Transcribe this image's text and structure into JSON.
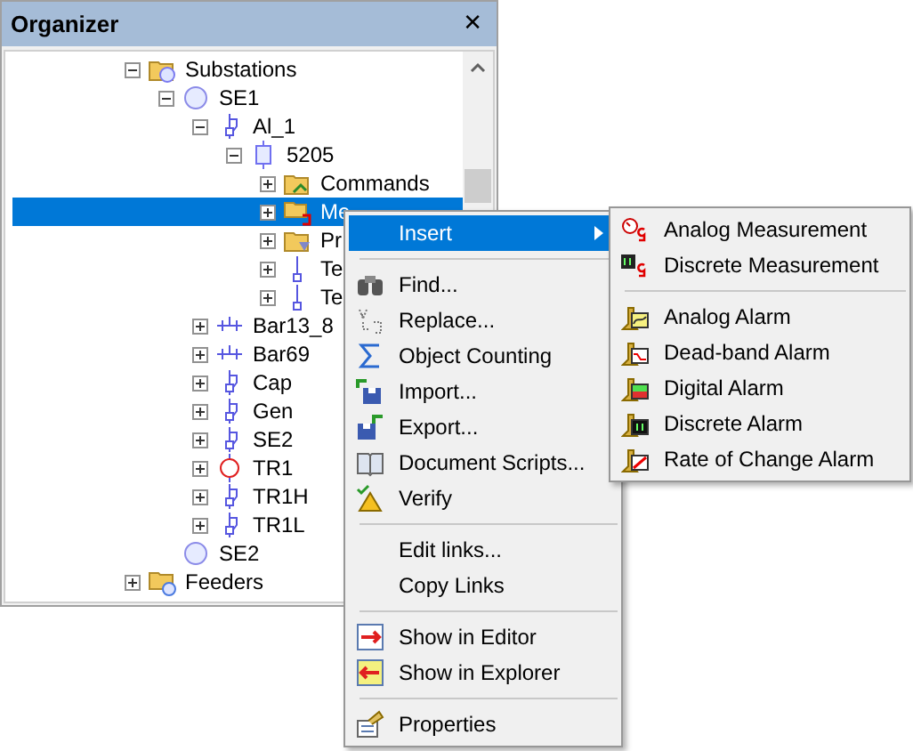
{
  "panel": {
    "title": "Organizer",
    "close": "✕"
  },
  "tree": [
    {
      "label": "Substations",
      "kind": "substations",
      "expandable": true,
      "expanded": true,
      "selected": false,
      "children": [
        {
          "label": "SE1",
          "kind": "substation",
          "expandable": true,
          "expanded": true,
          "selected": false,
          "children": [
            {
              "label": "Al_1",
              "kind": "breaker",
              "expandable": true,
              "expanded": true,
              "selected": false,
              "children": [
                {
                  "label": "5205",
                  "kind": "bay",
                  "expandable": true,
                  "expanded": true,
                  "selected": false,
                  "children": [
                    {
                      "label": "Commands",
                      "kind": "commands",
                      "expandable": true,
                      "expanded": false,
                      "selected": false
                    },
                    {
                      "label": "Me",
                      "kind": "measurements",
                      "expandable": true,
                      "expanded": false,
                      "selected": true
                    },
                    {
                      "label": "Pr",
                      "kind": "protection",
                      "expandable": true,
                      "expanded": false,
                      "selected": false
                    },
                    {
                      "label": "Te",
                      "kind": "terminal",
                      "expandable": true,
                      "expanded": false,
                      "selected": false
                    },
                    {
                      "label": "Te",
                      "kind": "terminal",
                      "expandable": true,
                      "expanded": false,
                      "selected": false
                    }
                  ]
                }
              ]
            },
            {
              "label": "Bar13_8",
              "kind": "busbar",
              "expandable": true,
              "expanded": false,
              "selected": false
            },
            {
              "label": "Bar69",
              "kind": "busbar",
              "expandable": true,
              "expanded": false,
              "selected": false
            },
            {
              "label": "Cap",
              "kind": "breaker",
              "expandable": true,
              "expanded": false,
              "selected": false
            },
            {
              "label": "Gen",
              "kind": "breaker",
              "expandable": true,
              "expanded": false,
              "selected": false
            },
            {
              "label": "SE2",
              "kind": "breaker",
              "expandable": true,
              "expanded": false,
              "selected": false
            },
            {
              "label": "TR1",
              "kind": "transformer",
              "expandable": true,
              "expanded": false,
              "selected": false
            },
            {
              "label": "TR1H",
              "kind": "breaker",
              "expandable": true,
              "expanded": false,
              "selected": false
            },
            {
              "label": "TR1L",
              "kind": "breaker",
              "expandable": true,
              "expanded": false,
              "selected": false
            }
          ]
        },
        {
          "label": "SE2",
          "kind": "substation",
          "expandable": false,
          "selected": false
        }
      ]
    },
    {
      "label": "Feeders",
      "kind": "feeders",
      "expandable": true,
      "expanded": false,
      "selected": false
    }
  ],
  "context_menu": [
    {
      "kind": "item",
      "label": "Insert",
      "selected": true,
      "submenu": true
    },
    {
      "kind": "separator"
    },
    {
      "kind": "item",
      "label": "Find...",
      "selected": false,
      "submenu": false
    },
    {
      "kind": "item",
      "label": "Replace...",
      "selected": false,
      "submenu": false
    },
    {
      "kind": "item",
      "label": "Object Counting",
      "selected": false,
      "submenu": false
    },
    {
      "kind": "item",
      "label": "Import...",
      "selected": false,
      "submenu": false
    },
    {
      "kind": "item",
      "label": "Export...",
      "selected": false,
      "submenu": false
    },
    {
      "kind": "item",
      "label": "Document Scripts...",
      "selected": false,
      "submenu": false
    },
    {
      "kind": "item",
      "label": "Verify",
      "selected": false,
      "submenu": false
    },
    {
      "kind": "separator"
    },
    {
      "kind": "item",
      "label": "Edit links...",
      "selected": false,
      "submenu": false
    },
    {
      "kind": "item",
      "label": "Copy Links",
      "selected": false,
      "submenu": false
    },
    {
      "kind": "separator"
    },
    {
      "kind": "item",
      "label": "Show in Editor",
      "selected": false,
      "submenu": false
    },
    {
      "kind": "item",
      "label": "Show in Explorer",
      "selected": false,
      "submenu": false
    },
    {
      "kind": "separator"
    },
    {
      "kind": "item",
      "label": "Properties",
      "selected": false,
      "submenu": false
    }
  ],
  "submenu": [
    {
      "kind": "item",
      "label": "Analog Measurement",
      "selected": false
    },
    {
      "kind": "item",
      "label": "Discrete Measurement",
      "selected": false
    },
    {
      "kind": "separator"
    },
    {
      "kind": "item",
      "label": "Analog Alarm",
      "selected": false
    },
    {
      "kind": "item",
      "label": "Dead-band Alarm",
      "selected": false
    },
    {
      "kind": "item",
      "label": "Digital Alarm",
      "selected": false
    },
    {
      "kind": "item",
      "label": "Discrete Alarm",
      "selected": false
    },
    {
      "kind": "item",
      "label": "Rate of Change Alarm",
      "selected": false
    }
  ]
}
